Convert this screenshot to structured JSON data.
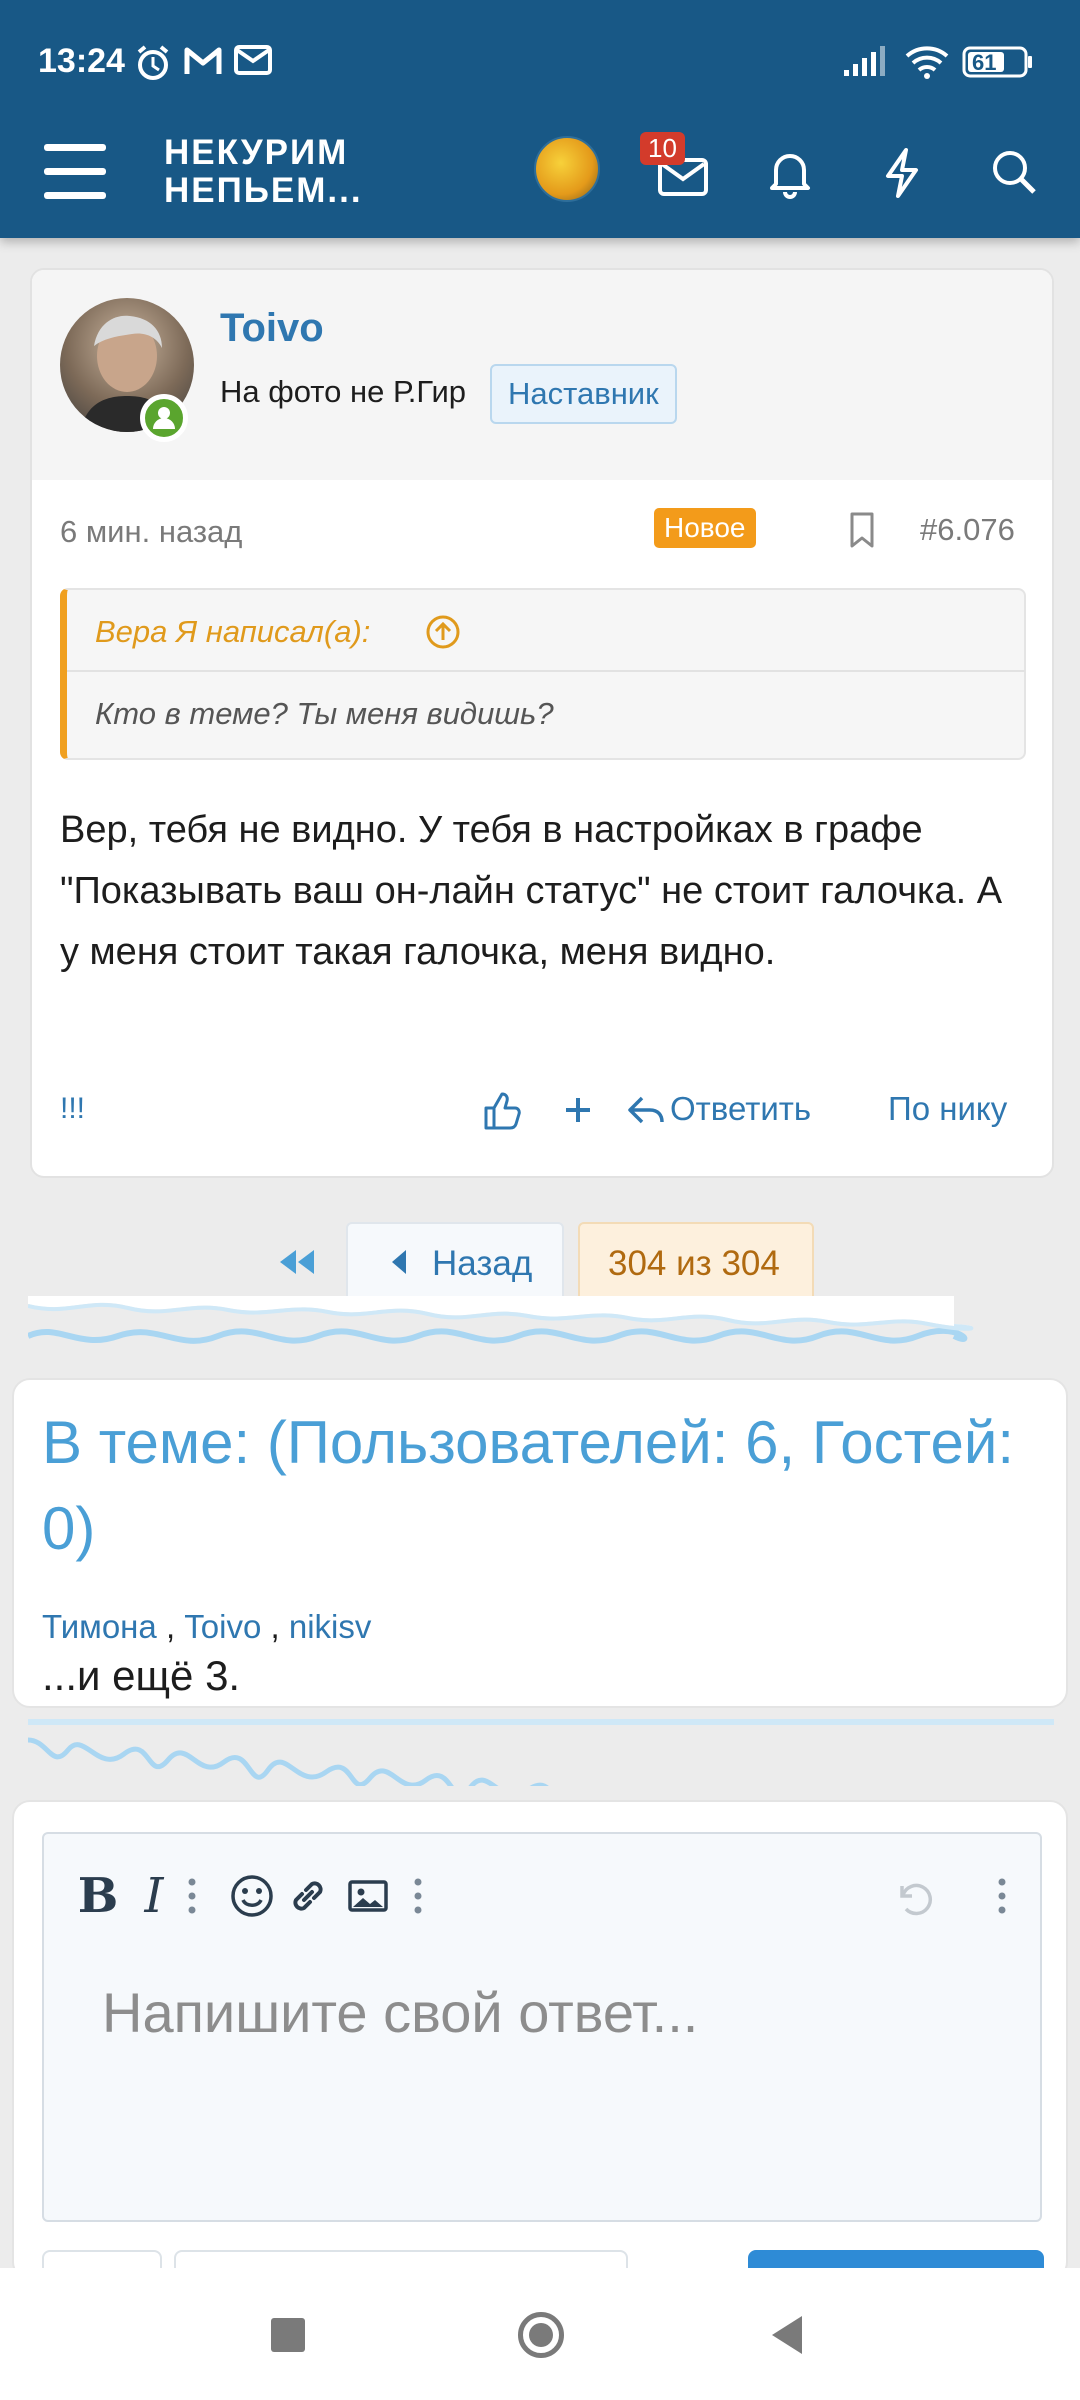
{
  "status_bar": {
    "time": "13:24",
    "battery": "61"
  },
  "header": {
    "logo_line1": "НЕКУРИМ",
    "logo_line2": "НЕПЬЕМ...",
    "inbox_count": "10",
    "icons": [
      "menu-icon",
      "avatar",
      "envelope-icon",
      "bell-icon",
      "lightning-icon",
      "search-icon"
    ]
  },
  "post": {
    "author": "Toivo",
    "user_title": "На фото не Р.Гир",
    "banner": "Наставник",
    "time": "6 мин. назад",
    "new_label": "Новое",
    "number": "#6.076",
    "quote": {
      "author": "Вера Я написал(а):",
      "text": "Кто в теме? Ты меня видишь?"
    },
    "body": "Вер, тебя не видно. У тебя в настройках в графе \"Показывать ваш он-лайн статус\" не стоит галочка. А у меня стоит такая галочка, меня видно.",
    "actions": {
      "report": "!!!",
      "reply": "Ответить",
      "by_nick": "По нику"
    }
  },
  "pager": {
    "back": "Назад",
    "current": "304 из 304"
  },
  "online": {
    "title": "В теме: (Пользователей: 6, Гостей: 0)",
    "users": [
      "Тимона",
      "Toivo",
      "nikisv"
    ],
    "separator": ",",
    "more": "...и ещё 3."
  },
  "editor": {
    "placeholder": "Напишите свой ответ..."
  },
  "colors": {
    "header": "#185886",
    "link": "#2f77b0",
    "quote_accent": "#f0a020",
    "new_badge": "#f39b1a"
  }
}
